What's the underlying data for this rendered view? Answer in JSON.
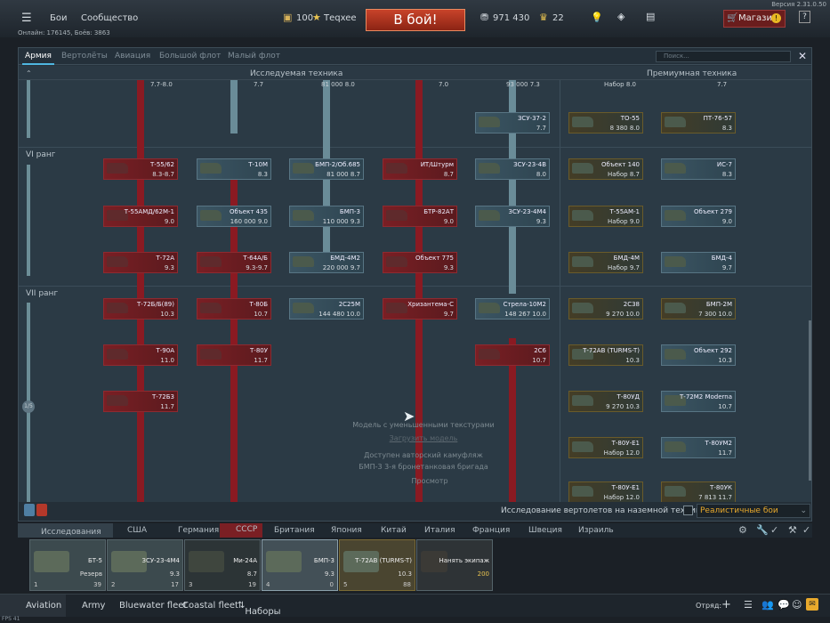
{
  "topbar": {
    "battles": "Бои",
    "community": "Сообщество",
    "rp": "100",
    "rp_unit": "Теqxee",
    "fight": "В бой!",
    "silver": "971 430",
    "gold": "22",
    "shop": "Магазин"
  },
  "online": "Онлайн: 176145, Боёв: 3863",
  "version": "Версия 2.31.0.50",
  "tabs": [
    "Армия",
    "Вертолёты",
    "Авиация",
    "Большой флот",
    "Малый флот"
  ],
  "search_placeholder": "Поиск...",
  "columns": {
    "research": "Исследуемая техника",
    "premium": "Премиумная техника"
  },
  "ranks": {
    "vi": "VI ранг",
    "vii": "VII ранг"
  },
  "top_partial": [
    "7.7-8.0",
    "7.7",
    "81 000 8.0",
    "7.0",
    "93 000 7.3",
    "Набор 8.0",
    "7.7"
  ],
  "cards": [
    {
      "name": "ЗСУ-37-2",
      "val": "7.7"
    },
    {
      "name": "ТО-55",
      "val": "8 380  8.0"
    },
    {
      "name": "ПТ-76-57",
      "val": "8.3"
    },
    {
      "name": "Т-55/62",
      "val": "8.3-8.7"
    },
    {
      "name": "Т-10М",
      "val": "8.3"
    },
    {
      "name": "БМП-2/Об.685",
      "val": "81 000  8.7"
    },
    {
      "name": "ИТ/Штурм",
      "val": "8.7"
    },
    {
      "name": "ЗСУ-23-4В",
      "val": "8.0"
    },
    {
      "name": "Объект 140",
      "val": "Набор 8.7"
    },
    {
      "name": "ИС-7",
      "val": "8.3"
    },
    {
      "name": "Т-55АМД/62М-1",
      "val": "9.0"
    },
    {
      "name": "Объект 435",
      "val": "160 000  9.0"
    },
    {
      "name": "БМП-3",
      "val": "110 000  9.3"
    },
    {
      "name": "БТР-82АТ",
      "val": "9.0"
    },
    {
      "name": "ЗСУ-23-4М4",
      "val": "9.3"
    },
    {
      "name": "Т-55АМ-1",
      "val": "Набор 9.0"
    },
    {
      "name": "Объект 279",
      "val": "9.0"
    },
    {
      "name": "Т-72А",
      "val": "9.3"
    },
    {
      "name": "Т-64А/Б",
      "val": "9.3-9.7"
    },
    {
      "name": "БМД-4М2",
      "val": "220 000  9.7"
    },
    {
      "name": "Объект 775",
      "val": "9.3"
    },
    {
      "name": "БМД-4М",
      "val": "Набор 9.7"
    },
    {
      "name": "БМД-4",
      "val": "9.7"
    },
    {
      "name": "Т-72Б/Б(89)",
      "val": "10.3"
    },
    {
      "name": "Т-80Б",
      "val": "10.7"
    },
    {
      "name": "2С25М",
      "val": "144 480  10.0"
    },
    {
      "name": "Хризантема-С",
      "val": "9.7"
    },
    {
      "name": "Стрела-10М2",
      "val": "148 267  10.0"
    },
    {
      "name": "2С38",
      "val": "9 270  10.0"
    },
    {
      "name": "БМП-2М",
      "val": "7 300  10.0"
    },
    {
      "name": "Т-90А",
      "val": "11.0"
    },
    {
      "name": "Т-80У",
      "val": "11.7"
    },
    {
      "name": "2С6",
      "val": "10.7"
    },
    {
      "name": "Т-72АВ (TURMS-T)",
      "val": "10.3"
    },
    {
      "name": "Объект 292",
      "val": "10.3"
    },
    {
      "name": "Т-72Б3",
      "val": "11.7"
    },
    {
      "name": "Т-80УД",
      "val": "9 270  10.3"
    },
    {
      "name": "Т-72М2 Moderna",
      "val": "10.7"
    },
    {
      "name": "Т-80У-Е1",
      "val": "Набор 12.0"
    },
    {
      "name": "Т-80УМ2",
      "val": "11.7"
    },
    {
      "name": "Т-80У-Е1",
      "val": "Набор 12.0"
    },
    {
      "name": "Т-80УК",
      "val": "7 813  11.7"
    }
  ],
  "model_info": [
    "Модель с уменьшенными текстурами",
    "Загрузить модель",
    "Доступен авторский камуфляж",
    "БМП-3 3-я бронетанковая бригада",
    "Просмотр"
  ],
  "heli_research": "Исследование вертолетов на наземной технике",
  "realistic": "Реалистичные бои",
  "page_indicator": "1/5",
  "crew_header": "Исследования",
  "nations": [
    "США",
    "Германия",
    "СССР",
    "Британия",
    "Япония",
    "Китай",
    "Италия",
    "Франция",
    "Швеция",
    "Израиль"
  ],
  "slots": [
    {
      "name": "БТ-5",
      "status": "Резерв",
      "ix": "1",
      "xp": "39"
    },
    {
      "name": "ЗСУ-23-4М4",
      "status": "9.3",
      "ix": "2",
      "xp": "17"
    },
    {
      "name": "Ми-24А",
      "status": "8.7",
      "ix": "3",
      "xp": "19"
    },
    {
      "name": "БМП-3",
      "status": "9.3",
      "ix": "4",
      "xp": "0"
    },
    {
      "name": "Т-72АВ (TURMS-T)",
      "status": "10.3",
      "ix": "5",
      "xp": "88"
    },
    {
      "name": "Нанять экипаж",
      "status": "200"
    }
  ],
  "footer": [
    "Aviation",
    "Army",
    "Bluewater fleet",
    "Coastal fleet",
    "Наборы"
  ],
  "squad": "Отряд:",
  "fps": "FPS 41"
}
